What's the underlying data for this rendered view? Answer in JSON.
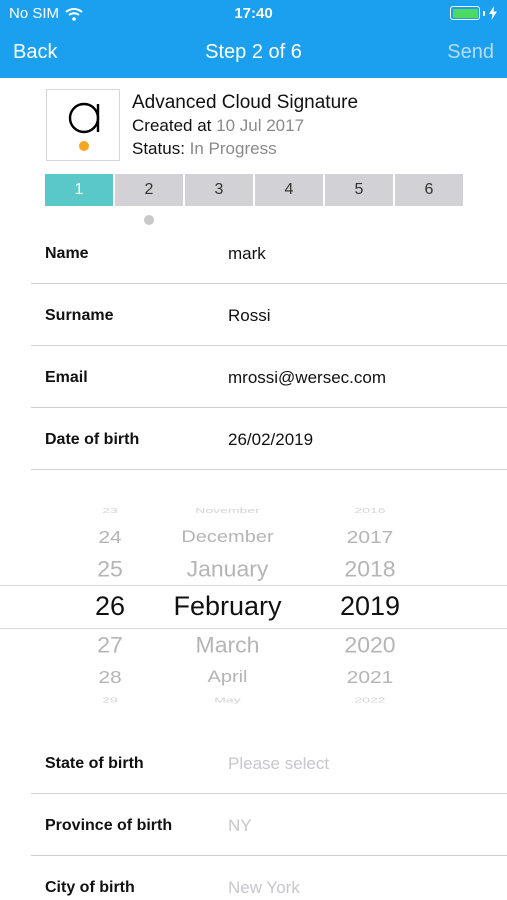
{
  "status_bar": {
    "carrier": "No SIM",
    "time": "17:40",
    "battery_level": 1.0
  },
  "nav": {
    "back": "Back",
    "title": "Step 2 of 6",
    "send": "Send"
  },
  "document": {
    "title": "Advanced Cloud Signature",
    "created_label": "Created at",
    "created_value": "10 Jul 2017",
    "status_label": "Status:",
    "status_value": "In Progress"
  },
  "steps": [
    "1",
    "2",
    "3",
    "4",
    "5",
    "6"
  ],
  "form_top": [
    {
      "label": "Name",
      "value": "mark"
    },
    {
      "label": "Surname",
      "value": "Rossi"
    },
    {
      "label": "Email",
      "value": "mrossi@wersec.com"
    },
    {
      "label": "Date of birth",
      "value": "26/02/2019"
    }
  ],
  "picker": {
    "days": [
      "23",
      "24",
      "25",
      "26",
      "27",
      "28",
      "29"
    ],
    "months": [
      "November",
      "December",
      "January",
      "February",
      "March",
      "April",
      "May"
    ],
    "years": [
      "2016",
      "2017",
      "2018",
      "2019",
      "2020",
      "2021",
      "2022"
    ]
  },
  "form_bottom": [
    {
      "label": "State of birth",
      "placeholder": "Please select"
    },
    {
      "label": "Province of birth",
      "placeholder": "NY"
    },
    {
      "label": "City of birth",
      "placeholder": "New York"
    }
  ],
  "colors": {
    "header": "#1aa0ee",
    "step_active": "#5ac8c8",
    "step_inactive": "#d1d1d6",
    "logo_dot": "#f5a623"
  }
}
